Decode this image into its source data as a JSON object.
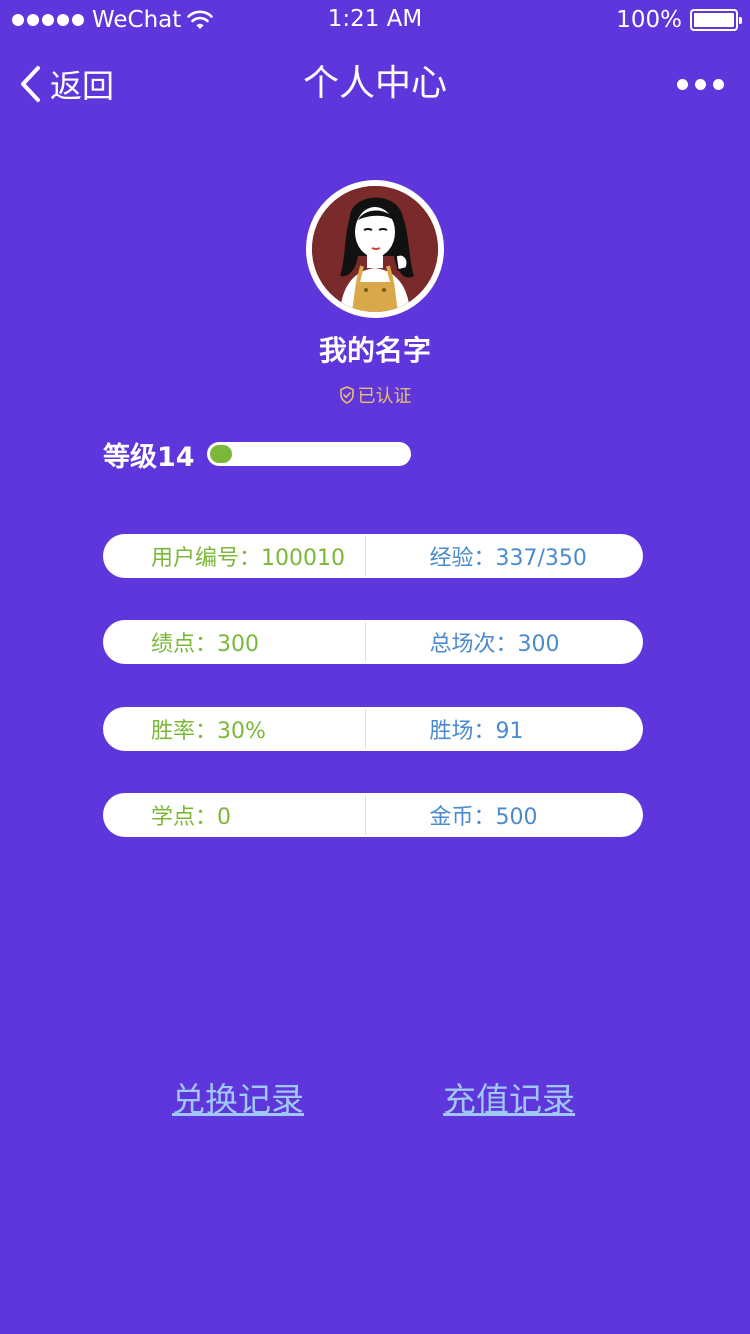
{
  "status_bar": {
    "carrier": "WeChat",
    "time": "1:21 AM",
    "battery": "100%",
    "icons": [
      "signal-dots-icon",
      "wifi-icon",
      "battery-icon"
    ]
  },
  "nav": {
    "back_label": "返回",
    "title": "个人中心",
    "more_icon": "more-dots-icon",
    "back_icon": "chevron-left-icon"
  },
  "profile": {
    "name": "我的名字",
    "verified_label": "已认证",
    "verified_icon": "shield-check-icon",
    "avatar": "avatar-illustration"
  },
  "level": {
    "label": "等级14",
    "progress_fraction": 0.11
  },
  "stats": [
    {
      "left": "用户编号：100010",
      "right": "经验：337/350"
    },
    {
      "left": "绩点：300",
      "right": "总场次：300"
    },
    {
      "left": "胜率：30%",
      "right": "胜场：91"
    },
    {
      "left": "学点：0",
      "right": "金币：500"
    }
  ],
  "links": {
    "exchange": "兑换记录",
    "recharge": "充值记录"
  },
  "colors": {
    "background": "#5f36dc",
    "stat_left_text": "#7bb83a",
    "stat_right_text": "#4a8bd0",
    "verified": "#e9c06a",
    "progress": "#7bb83a",
    "link": "#9fc8f5"
  }
}
